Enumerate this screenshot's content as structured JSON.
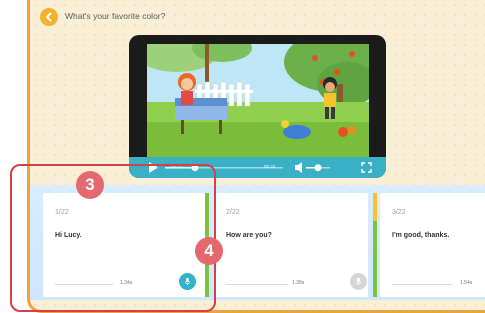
{
  "header": {
    "title": "What's your favorite color?"
  },
  "player": {
    "elapsed": "00:01",
    "total": "00:33",
    "progress": 0.32,
    "volume": 0.55
  },
  "cards": [
    {
      "index": "1/22",
      "text": "Hi Lucy.",
      "duration": "1.34s",
      "mic_state": "active"
    },
    {
      "index": "2/22",
      "text": "How are you?",
      "duration": "1.38s",
      "mic_state": "disabled"
    },
    {
      "index": "3/22",
      "text": "I'm good, thanks.",
      "duration": "1.54s",
      "mic_state": "none"
    }
  ],
  "annotations": {
    "badge_a": "3",
    "badge_b": "4"
  },
  "colors": {
    "accent": "#3ab0c6",
    "frame": "#f0a33c",
    "highlight": "#d14246",
    "badge": "#e3696e"
  }
}
